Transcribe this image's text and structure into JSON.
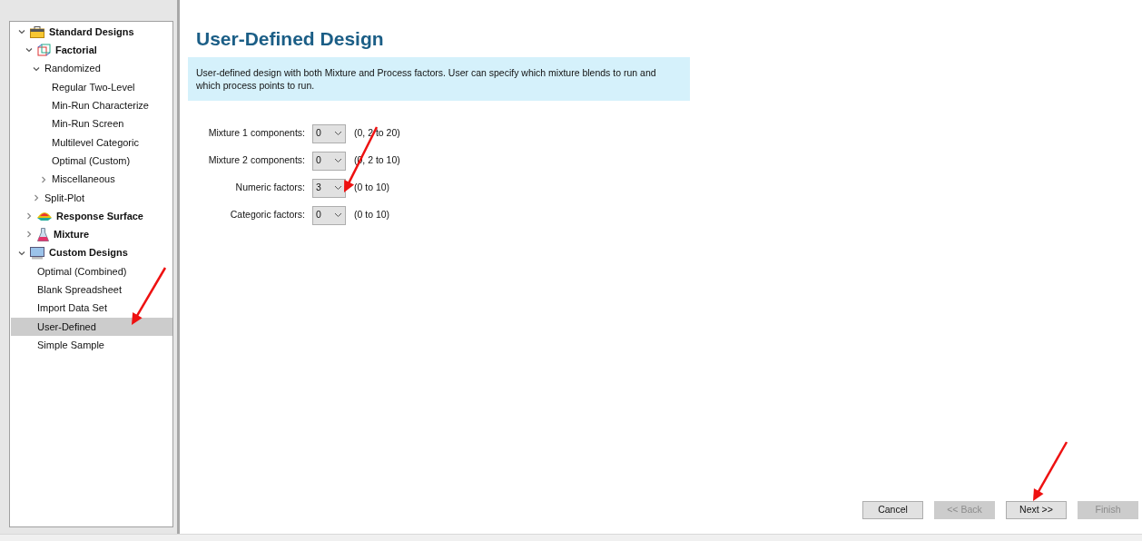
{
  "tree": [
    {
      "label": "Standard Designs",
      "expanded": true,
      "selected": false,
      "children": [
        {
          "label": "Factorial",
          "expanded": true,
          "selected": false,
          "children": [
            {
              "label": "Randomized",
              "expanded": true,
              "selected": false,
              "children": [
                {
                  "label": "Regular Two-Level",
                  "selected": false
                },
                {
                  "label": "Min-Run Characterize",
                  "selected": false
                },
                {
                  "label": "Min-Run Screen",
                  "selected": false
                },
                {
                  "label": "Multilevel Categoric",
                  "selected": false
                },
                {
                  "label": "Optimal (Custom)",
                  "selected": false
                },
                {
                  "label": "Miscellaneous",
                  "expanded": false,
                  "selected": false
                }
              ]
            },
            {
              "label": "Split-Plot",
              "expanded": false,
              "selected": false
            }
          ]
        },
        {
          "label": "Response Surface",
          "expanded": false,
          "selected": false
        },
        {
          "label": "Mixture",
          "expanded": false,
          "selected": false
        }
      ]
    },
    {
      "label": "Custom Designs",
      "expanded": true,
      "selected": false,
      "children": [
        {
          "label": "Optimal (Combined)",
          "selected": false
        },
        {
          "label": "Blank Spreadsheet",
          "selected": false
        },
        {
          "label": "Import Data Set",
          "selected": false
        },
        {
          "label": "User-Defined",
          "selected": true
        },
        {
          "label": "Simple Sample",
          "selected": false
        }
      ]
    }
  ],
  "title": "User-Defined Design",
  "description": "User-defined design with both Mixture and Process factors. User can specify which mixture blends to run and which process points to run.",
  "fields": [
    {
      "label": "Mixture 1 components:",
      "value": "0",
      "range": "(0, 2 to 20)"
    },
    {
      "label": "Mixture 2 components:",
      "value": "0",
      "range": "(0, 2 to 10)"
    },
    {
      "label": "Numeric factors:",
      "value": "3",
      "range": "(0 to 10)"
    },
    {
      "label": "Categoric factors:",
      "value": "0",
      "range": "(0 to 10)"
    }
  ],
  "buttons": [
    {
      "label": "Cancel",
      "disabled": false
    },
    {
      "label": "<< Back",
      "disabled": true
    },
    {
      "label": "Next >>",
      "disabled": false
    },
    {
      "label": "Finish",
      "disabled": true
    }
  ]
}
